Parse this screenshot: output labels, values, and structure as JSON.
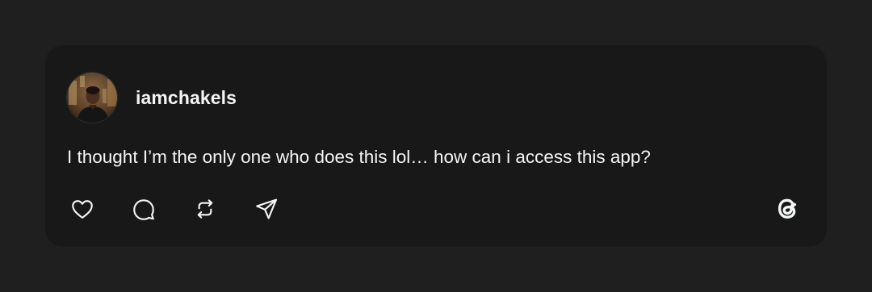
{
  "post": {
    "username": "iamchakels",
    "text": "I thought I’m the only one who does this lol… how can i access this app?"
  },
  "actions": {
    "like_icon": "heart-icon",
    "reply_icon": "comment-icon",
    "repost_icon": "repost-icon",
    "share_icon": "send-icon"
  },
  "brand": {
    "logo_icon": "threads-logo-icon"
  },
  "colors": {
    "background": "#1f1f1f",
    "card": "#181818",
    "text": "#f3f5f7"
  }
}
